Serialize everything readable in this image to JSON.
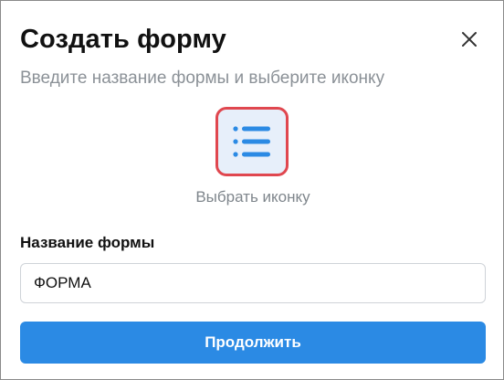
{
  "dialog": {
    "title": "Создать форму",
    "subtitle": "Введите название формы и выберите иконку",
    "close_icon": "close-icon"
  },
  "icon_picker": {
    "icon": "list-icon",
    "label": "Выбрать иконку",
    "accent_color": "#2b8ae4",
    "highlight_border_color": "#e0474f"
  },
  "form_name": {
    "label": "Название формы",
    "value": "ФОРМА",
    "placeholder": ""
  },
  "continue_button": {
    "label": "Продолжить",
    "color": "#2b8ae4"
  }
}
